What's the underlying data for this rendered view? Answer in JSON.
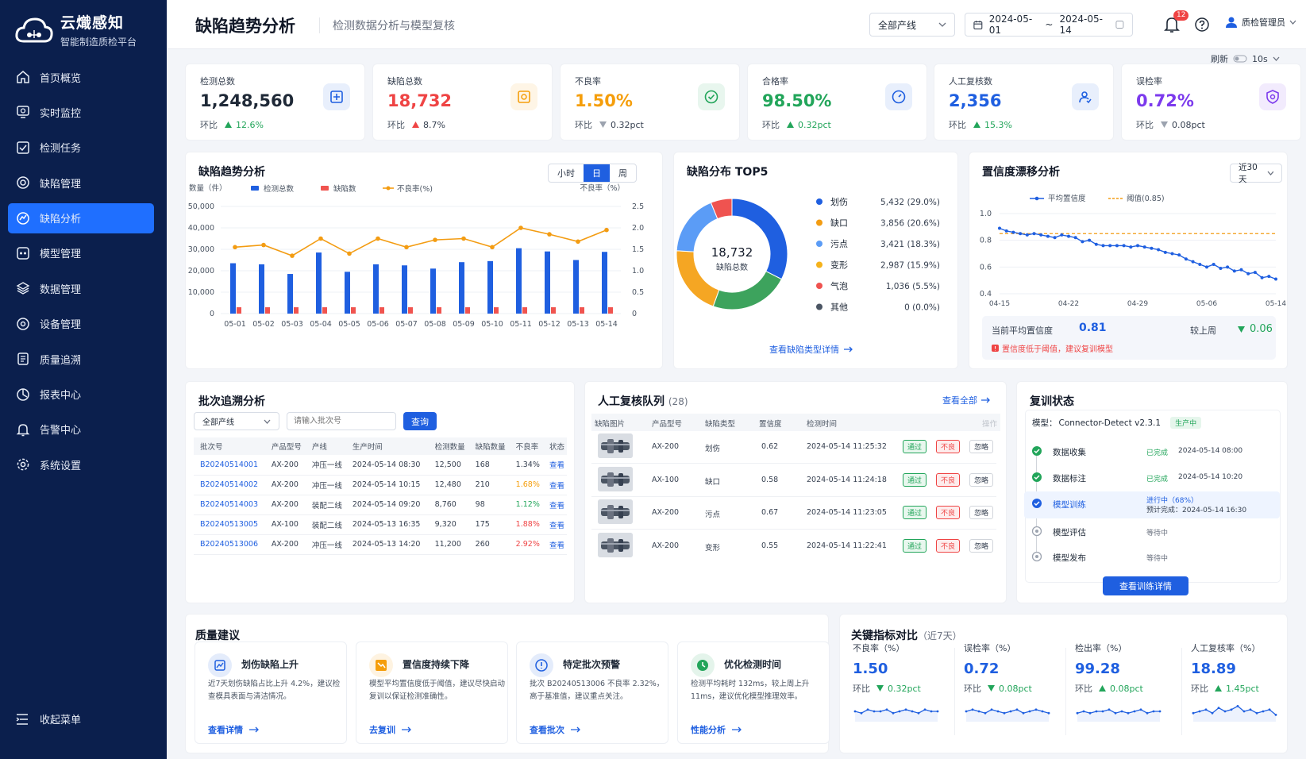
{
  "brand": {
    "title": "云熾感知",
    "subtitle": "智能制造质检平台"
  },
  "nav": [
    {
      "label": "首页概览",
      "icon": "home-icon"
    },
    {
      "label": "实时监控",
      "icon": "monitor-icon"
    },
    {
      "label": "检测任务",
      "icon": "task-icon"
    },
    {
      "label": "缺陷管理",
      "icon": "defect-icon"
    },
    {
      "label": "缺陷分析",
      "icon": "analysis-icon"
    },
    {
      "label": "模型管理",
      "icon": "model-icon"
    },
    {
      "label": "数据管理",
      "icon": "data-icon"
    },
    {
      "label": "设备管理",
      "icon": "device-icon"
    },
    {
      "label": "质量追溯",
      "icon": "trace-icon"
    },
    {
      "label": "报表中心",
      "icon": "report-icon"
    },
    {
      "label": "告警中心",
      "icon": "bell-icon"
    },
    {
      "label": "系统设置",
      "icon": "gear-icon"
    }
  ],
  "collapse_label": "收起菜单",
  "header": {
    "title": "缺陷趋势分析",
    "subtitle": "检测数据分析与模型复核",
    "line_select": "全部产线",
    "date_start": "2024-05-01",
    "date_sep": "~",
    "date_end": "2024-05-14",
    "notif_count": "12",
    "user": "质检管理员",
    "refresh_label": "刷新",
    "refresh_interval": "10s"
  },
  "kpis": [
    {
      "label": "检测总数",
      "value": "1,248,560",
      "cmp_label": "环比",
      "cmp_value": "12.6%",
      "trend": "up",
      "color": "#1f2937",
      "accent": "#1f5fe0",
      "icon": "scan-icon"
    },
    {
      "label": "缺陷总数",
      "value": "18,732",
      "cmp_label": "环比",
      "cmp_value": "8.7%",
      "trend": "up-bad",
      "color": "#ef4444",
      "accent": "#f59e0b",
      "icon": "alert-box-icon"
    },
    {
      "label": "不良率",
      "value": "1.50%",
      "cmp_label": "环比",
      "cmp_value": "0.32pct",
      "trend": "down",
      "color": "#f59e0b",
      "accent": "#22a55a",
      "icon": "check-circle-icon"
    },
    {
      "label": "合格率",
      "value": "98.50%",
      "cmp_label": "环比",
      "cmp_value": "0.32pct",
      "trend": "up",
      "color": "#22a55a",
      "accent": "#1f5fe0",
      "icon": "gauge-icon"
    },
    {
      "label": "人工复核数",
      "value": "2,356",
      "cmp_label": "环比",
      "cmp_value": "15.3%",
      "trend": "up",
      "color": "#1f5fe0",
      "accent": "#1f5fe0",
      "icon": "reviewer-icon"
    },
    {
      "label": "误检率",
      "value": "0.72%",
      "cmp_label": "环比",
      "cmp_value": "0.08pct",
      "trend": "down",
      "color": "#7c3aed",
      "accent": "#7c3aed",
      "icon": "shield-icon"
    }
  ],
  "trend_card": {
    "title": "缺陷趋势分析",
    "tabs": [
      "小时",
      "日",
      "周"
    ],
    "active_tab": "日",
    "y_left_title": "数量（件）",
    "y_right_title": "不良率（%）",
    "legend": [
      "检测总数",
      "缺陷数",
      "不良率(%)"
    ],
    "y_left_ticks": [
      "50,000",
      "40,000",
      "30,000",
      "20,000",
      "10,000",
      "0"
    ],
    "y_right_ticks": [
      "2.5",
      "2.0",
      "1.5",
      "1.0",
      "0.5",
      "0"
    ]
  },
  "chart_data": [
    {
      "type": "bar",
      "title": "缺陷趋势分析",
      "categories": [
        "05-01",
        "05-02",
        "05-03",
        "05-04",
        "05-05",
        "05-06",
        "05-07",
        "05-08",
        "05-09",
        "05-10",
        "05-11",
        "05-12",
        "05-13",
        "05-14"
      ],
      "ylabel": "数量（件）",
      "y2label": "不良率（%）",
      "ylim": [
        0,
        50000
      ],
      "y2lim": [
        0,
        2.5
      ],
      "series": [
        {
          "name": "检测总数",
          "kind": "bar",
          "color": "#1f5fe0",
          "values": [
            23500,
            23000,
            18500,
            28500,
            19500,
            23000,
            22500,
            21000,
            24000,
            24500,
            30500,
            29000,
            25000,
            28800
          ]
        },
        {
          "name": "缺陷数",
          "kind": "bar",
          "color": "#f0544f",
          "values": [
            700,
            700,
            700,
            750,
            700,
            700,
            700,
            700,
            700,
            700,
            750,
            700,
            700,
            700
          ]
        },
        {
          "name": "不良率(%)",
          "kind": "line",
          "axis": "right",
          "color": "#f39c12",
          "values": [
            1.55,
            1.6,
            1.35,
            1.75,
            1.4,
            1.75,
            1.55,
            1.72,
            1.75,
            1.55,
            2.0,
            1.85,
            1.68,
            1.95
          ]
        }
      ]
    },
    {
      "type": "pie",
      "title": "缺陷分布 TOP5",
      "center_value": "18,732",
      "center_label": "缺陷总数",
      "slices": [
        {
          "name": "划伤",
          "value": 5432,
          "pct": "29.0%",
          "color": "#1f5fe0"
        },
        {
          "name": "缺口",
          "value": 3856,
          "pct": "20.6%",
          "color": "#3da35d"
        },
        {
          "name": "污点",
          "value": 3421,
          "pct": "18.3%",
          "color": "#f5a623"
        },
        {
          "name": "变形",
          "value": 2987,
          "pct": "15.9%",
          "color": "#5b9cf6"
        },
        {
          "name": "气泡",
          "value": 1036,
          "pct": "5.5%",
          "color": "#ef5350"
        },
        {
          "name": "其他",
          "value": 0,
          "pct": "0.0%",
          "color": "#6b7280"
        }
      ],
      "legend_values": [
        "5,432 (29.0%)",
        "3,856 (20.6%)",
        "3,421 (18.3%)",
        "2,987 (15.9%)",
        "1,036 (5.5%)",
        "0 (0.0%)"
      ],
      "legend_colors": [
        "#1f5fe0",
        "#f39c12",
        "#5b9cf6",
        "#f5b21b",
        "#ef5350",
        "#4b5563"
      ]
    },
    {
      "type": "line",
      "title": "置信度漂移分析",
      "x_ticks": [
        "04-15",
        "04-22",
        "04-29",
        "05-06",
        "05-14"
      ],
      "ylim": [
        0.4,
        1.0
      ],
      "y_ticks": [
        "1.0",
        "0.8",
        "0.6",
        "0.4"
      ],
      "series": [
        {
          "name": "平均置信度",
          "color": "#1f5fe0",
          "values": [
            0.89,
            0.87,
            0.86,
            0.85,
            0.84,
            0.85,
            0.84,
            0.83,
            0.82,
            0.84,
            0.83,
            0.82,
            0.79,
            0.8,
            0.77,
            0.76,
            0.76,
            0.76,
            0.76,
            0.75,
            0.76,
            0.75,
            0.74,
            0.73,
            0.71,
            0.7,
            0.69,
            0.66,
            0.64,
            0.62,
            0.6,
            0.62,
            0.59,
            0.6,
            0.57,
            0.58,
            0.55,
            0.56,
            0.52,
            0.53,
            0.51
          ]
        },
        {
          "name": "阈值(0.85)",
          "color": "#f39c12",
          "dashed": true,
          "values": [
            0.85
          ]
        }
      ]
    }
  ],
  "distribution_card": {
    "title": "缺陷分布 TOP5",
    "link": "查看缺陷类型详情"
  },
  "drift_card": {
    "title": "置信度漂移分析",
    "range": "近30天",
    "legend": [
      "平均置信度",
      "阈值(0.85)"
    ],
    "current_label": "当前平均置信度",
    "current_value": "0.81",
    "week_label": "较上周",
    "week_value": "0.06",
    "warning": "置信度低于阈值，建议复训模型"
  },
  "batch_card": {
    "title": "批次追溯分析",
    "line_select": "全部产线",
    "search_placeholder": "请输入批次号",
    "query_button": "查询",
    "columns": [
      "批次号",
      "产品型号",
      "产线",
      "生产时间",
      "检测数量",
      "缺陷数量",
      "不良率",
      "状态"
    ],
    "rows": [
      [
        "B20240514001",
        "AX-200",
        "冲压一线",
        "2024-05-14 08:30",
        "12,500",
        "168",
        "1.34%",
        "查看"
      ],
      [
        "B20240514002",
        "AX-200",
        "冲压一线",
        "2024-05-14 10:15",
        "12,480",
        "210",
        "1.68%",
        "查看"
      ],
      [
        "B20240514003",
        "AX-200",
        "装配二线",
        "2024-05-14 09:20",
        "8,760",
        "98",
        "1.12%",
        "查看"
      ],
      [
        "B20240513005",
        "AX-100",
        "装配二线",
        "2024-05-13 16:35",
        "9,320",
        "175",
        "1.88%",
        "查看"
      ],
      [
        "B20240513006",
        "AX-200",
        "冲压一线",
        "2024-05-13 14:20",
        "11,200",
        "260",
        "2.92%",
        "查看"
      ]
    ],
    "rate_colors": [
      "#374151",
      "#f59e0b",
      "#22a55a",
      "#ef4444",
      "#ef4444"
    ]
  },
  "review_card": {
    "title": "人工复核队列",
    "count": "(28)",
    "view_all": "查看全部",
    "columns": [
      "缺陷图片",
      "产品型号",
      "缺陷类型",
      "置信度",
      "检测时间",
      "操作"
    ],
    "rows": [
      [
        "AX-200",
        "划伤",
        "0.62",
        "2024-05-14 11:25:32"
      ],
      [
        "AX-100",
        "缺口",
        "0.58",
        "2024-05-14 11:24:18"
      ],
      [
        "AX-200",
        "污点",
        "0.67",
        "2024-05-14 11:23:05"
      ],
      [
        "AX-200",
        "变形",
        "0.55",
        "2024-05-14 11:22:41"
      ]
    ],
    "actions": [
      "通过",
      "不良",
      "忽略"
    ]
  },
  "retrain_card": {
    "title": "复训状态",
    "model_label": "模型：",
    "model_name": "Connector-Detect v2.3.1",
    "model_status": "生产中",
    "steps": [
      {
        "name": "数据收集",
        "status": "已完成",
        "time": "2024-05-14 08:00",
        "state": "done"
      },
      {
        "name": "数据标注",
        "status": "已完成",
        "time": "2024-05-14 10:20",
        "state": "done"
      },
      {
        "name": "模型训练",
        "status": "进行中（68%）",
        "time": "预计完成：2024-05-14 16:30",
        "state": "active"
      },
      {
        "name": "模型评估",
        "status": "等待中",
        "time": "",
        "state": "wait"
      },
      {
        "name": "模型发布",
        "status": "等待中",
        "time": "",
        "state": "wait"
      }
    ],
    "button": "查看训练详情"
  },
  "suggestions": {
    "title": "质量建议",
    "items": [
      {
        "title": "划伤缺陷上升",
        "desc": "近7天划伤缺陷占比上升 4.2%，建议检查模具表面与清洁情况。",
        "link": "查看详情",
        "icon": "chart-up-icon",
        "color": "#1f5fe0"
      },
      {
        "title": "置信度持续下降",
        "desc": "模型平均置信度低于阈值，建议尽快启动复训以保证检测准确性。",
        "link": "去复训",
        "icon": "trend-down-icon",
        "color": "#f59e0b"
      },
      {
        "title": "特定批次预警",
        "desc": "批次 B20240513006 不良率 2.32%，高于基准值，建议重点关注。",
        "link": "查看批次",
        "icon": "warning-icon",
        "color": "#1f5fe0"
      },
      {
        "title": "优化检测时间",
        "desc": "检测平均耗时 132ms，较上周上升 11ms，建议优化模型推理效率。",
        "link": "性能分析",
        "icon": "clock-icon",
        "color": "#22a55a"
      }
    ]
  },
  "metrics": {
    "title": "关键指标对比",
    "range": "（近7天）",
    "items": [
      {
        "label": "不良率（%）",
        "value": "1.50",
        "cmp_label": "环比",
        "cmp": "0.32pct",
        "trend": "down",
        "spark": [
          5,
          4,
          6,
          5,
          5,
          6,
          4,
          5,
          6,
          5,
          4,
          6,
          5,
          5
        ]
      },
      {
        "label": "误检率（%）",
        "value": "0.72",
        "cmp_label": "环比",
        "cmp": "0.08pct",
        "trend": "down",
        "spark": [
          5,
          6,
          5,
          4,
          6,
          5,
          4,
          5,
          6,
          4,
          5,
          6,
          5,
          4
        ]
      },
      {
        "label": "检出率（%）",
        "value": "99.28",
        "cmp_label": "环比",
        "cmp": "0.08pct",
        "trend": "up",
        "spark": [
          4,
          5,
          4,
          5,
          5,
          6,
          4,
          5,
          4,
          5,
          6,
          4,
          5,
          5
        ]
      },
      {
        "label": "人工复核率（%）",
        "value": "18.89",
        "cmp_label": "环比",
        "cmp": "1.45pct",
        "trend": "up",
        "spark": [
          4,
          5,
          6,
          4,
          7,
          5,
          6,
          8,
          5,
          6,
          4,
          5,
          6,
          3
        ]
      }
    ]
  }
}
